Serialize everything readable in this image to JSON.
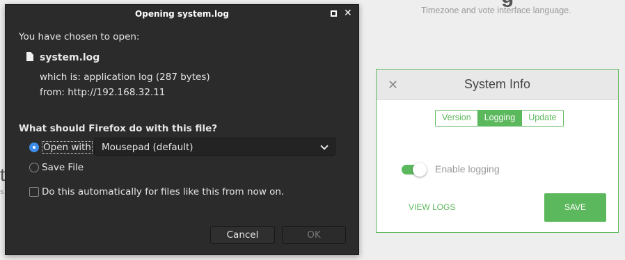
{
  "background": {
    "subtitle": "Timezone and vote interface language.",
    "title_fragment": "g",
    "left_fragment_1": "t",
    "left_fragment_2": "s"
  },
  "system_info": {
    "title": "System Info",
    "close_icon": "close-icon",
    "tabs": [
      {
        "label": "Version",
        "active": false
      },
      {
        "label": "Logging",
        "active": true
      },
      {
        "label": "Update",
        "active": false
      }
    ],
    "toggle_label": "Enable logging",
    "toggle_on": true,
    "view_logs_label": "VIEW LOGS",
    "save_label": "SAVE",
    "accent_color": "#5cb85c"
  },
  "download_dialog": {
    "title": "Opening system.log",
    "chosen_text": "You have chosen to open:",
    "file_name": "system.log",
    "which_is_label": "which is:",
    "which_is_value": "application log (287 bytes)",
    "from_label": "from:",
    "from_value": "http://192.168.32.11",
    "question": "What should Firefox do with this file?",
    "open_with_label": "Open with",
    "open_with_app": "Mousepad (default)",
    "save_file_label": "Save File",
    "auto_label": "Do this automatically for files like this from now on.",
    "cancel_label": "Cancel",
    "ok_label": "OK"
  }
}
